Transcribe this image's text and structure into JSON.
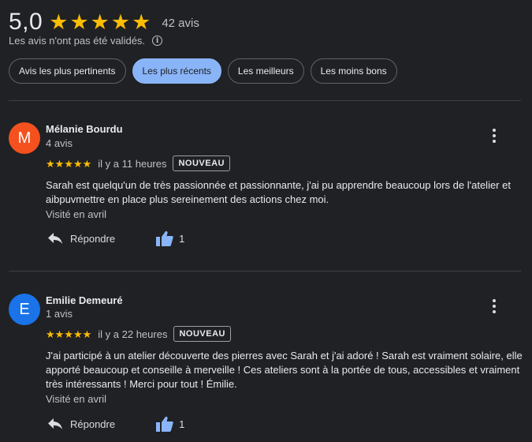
{
  "summary": {
    "score": "5,0",
    "stars": 5,
    "count": "42 avis",
    "disclaimer": "Les avis n'ont pas été validés."
  },
  "chips": [
    {
      "label": "Avis les plus pertinents",
      "active": false
    },
    {
      "label": "Les plus récents",
      "active": true
    },
    {
      "label": "Les meilleurs",
      "active": false
    },
    {
      "label": "Les moins bons",
      "active": false
    }
  ],
  "colors": {
    "star": "#fbbc04",
    "chip_active": "#8ab4f8",
    "avatar_1": "#f4511e",
    "avatar_2": "#1a73e8",
    "like_icon": "#8ab4f8"
  },
  "reviews": [
    {
      "initial": "M",
      "author": "Mélanie Bourdu",
      "author_meta": "4 avis",
      "stars": 5,
      "time": "il y a 11 heures",
      "badge": "NOUVEAU",
      "text": "Sarah est quelqu'un de très passionnée et passionnante, j'ai pu apprendre beaucoup lors de l'atelier et aibpuvmettre en place plus sereinement des actions chez moi.",
      "visited": "Visité en avril",
      "reply_label": "Répondre",
      "likes": "1"
    },
    {
      "initial": "E",
      "author": "Emilie Demeuré",
      "author_meta": "1 avis",
      "stars": 5,
      "time": "il y a 22 heures",
      "badge": "NOUVEAU",
      "text": "J'ai participé à un atelier découverte des pierres avec Sarah et j'ai adoré ! Sarah est vraiment solaire, elle apporté beaucoup et conseille à merveille ! Ces ateliers sont à la portée de tous, accessibles et vraiment très intéressants ! Merci pour tout ! Émilie.",
      "visited": "Visité en avril",
      "reply_label": "Répondre",
      "likes": "1"
    }
  ]
}
